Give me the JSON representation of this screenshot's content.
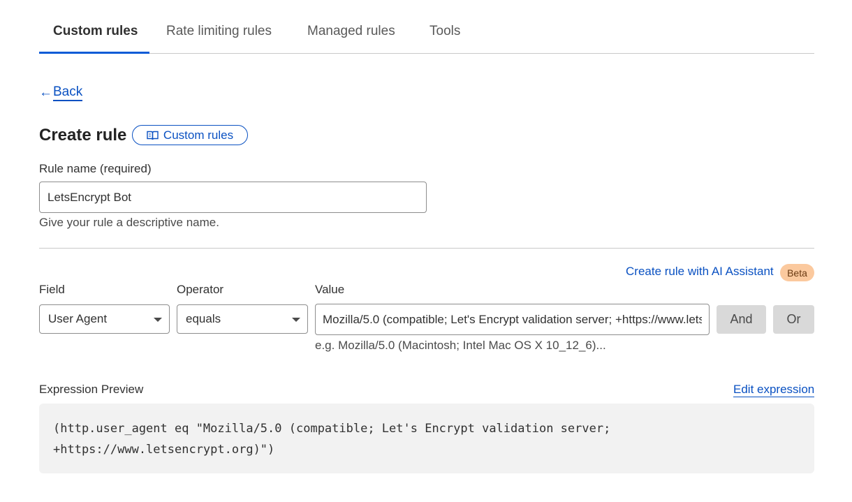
{
  "tabs": [
    {
      "label": "Custom rules",
      "active": true
    },
    {
      "label": "Rate limiting rules",
      "active": false
    },
    {
      "label": "Managed rules",
      "active": false
    },
    {
      "label": "Tools",
      "active": false
    }
  ],
  "back": {
    "arrow": "←",
    "label": "Back"
  },
  "page": {
    "title": "Create rule",
    "docs_link": "Custom rules"
  },
  "rule_name": {
    "label": "Rule name (required)",
    "value": "LetsEncrypt Bot",
    "hint": "Give your rule a descriptive name."
  },
  "ai": {
    "link": "Create rule with AI Assistant",
    "badge": "Beta"
  },
  "filter": {
    "field_label": "Field",
    "operator_label": "Operator",
    "value_label": "Value",
    "field_value": "User Agent",
    "operator_value": "equals",
    "value": "Mozilla/5.0 (compatible; Let's Encrypt validation server; +https://www.letsencrypt.org)",
    "value_hint": "e.g. Mozilla/5.0 (Macintosh; Intel Mac OS X 10_12_6)...",
    "and_label": "And",
    "or_label": "Or"
  },
  "expression": {
    "label": "Expression Preview",
    "edit_label": "Edit expression",
    "code": "(http.user_agent eq \"Mozilla/5.0 (compatible; Let's Encrypt validation server;\n+https://www.letsencrypt.org)\")"
  },
  "colors": {
    "accent": "#0a51c2",
    "tab_underline": "#0a5bd6",
    "beta_bg": "#fbc99e"
  }
}
